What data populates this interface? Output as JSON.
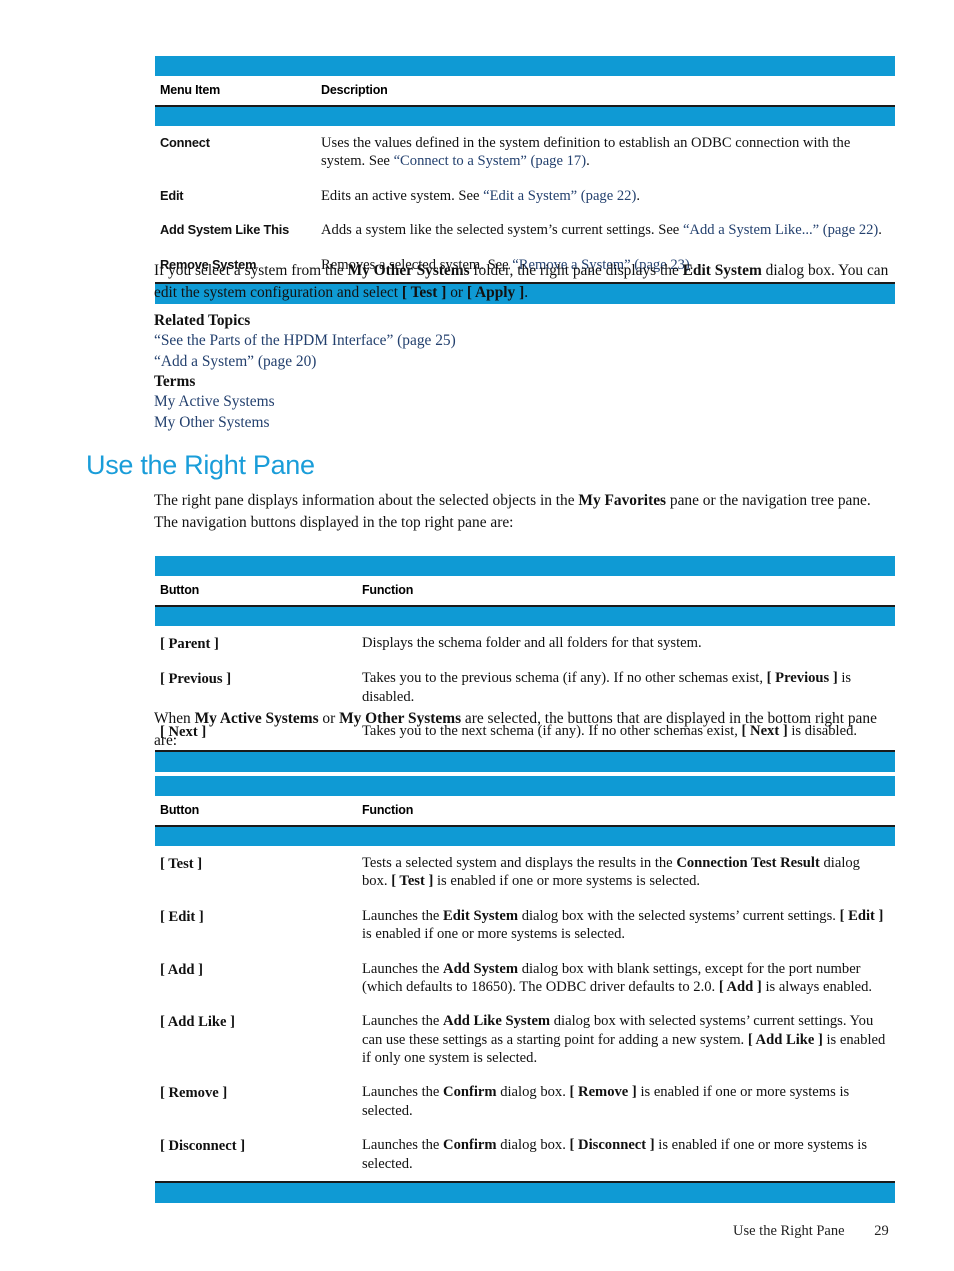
{
  "page": {
    "number": "29",
    "footer_title": "Use the Right Pane"
  },
  "colors": {
    "rule_cyan": "#0f9ad4",
    "rule_dark": "#1a1a1a",
    "heading": "#1a9dd9",
    "link": "#23406e"
  },
  "table_menu": {
    "headers": [
      "Menu Item",
      "Description"
    ],
    "rows": [
      {
        "key": "Connect",
        "desc_parts": [
          {
            "t": "Uses the values defined in the system definition to establish an ODBC connection with the system. See ",
            "style": "plain"
          },
          {
            "t": "“Connect to a System” (page 17)",
            "style": "link"
          },
          {
            "t": ".",
            "style": "plain"
          }
        ]
      },
      {
        "key": "Edit",
        "desc_parts": [
          {
            "t": "Edits an active system. See ",
            "style": "plain"
          },
          {
            "t": "“Edit a System” (page 22)",
            "style": "link"
          },
          {
            "t": ".",
            "style": "plain"
          }
        ]
      },
      {
        "key": "Add System Like This",
        "desc_parts": [
          {
            "t": "Adds a system like the selected system’s current settings. See ",
            "style": "plain"
          },
          {
            "t": "“Add a System Like...” (page 22)",
            "style": "link"
          },
          {
            "t": ".",
            "style": "plain"
          }
        ]
      },
      {
        "key": "Remove System",
        "desc_parts": [
          {
            "t": "Removes a selected system. See ",
            "style": "plain"
          },
          {
            "t": "“Remove a System” (page 23)",
            "style": "link"
          },
          {
            "t": ".",
            "style": "plain"
          }
        ]
      }
    ]
  },
  "para_other_systems": {
    "parts": [
      {
        "t": "If you select a system from the ",
        "style": "plain"
      },
      {
        "t": "My Other Systems",
        "style": "bold"
      },
      {
        "t": " folder, the right pane displays the ",
        "style": "plain"
      },
      {
        "t": "Edit System",
        "style": "bold"
      },
      {
        "t": " dialog box. You can edit the system configuration and select ",
        "style": "plain"
      },
      {
        "t": "[ Test ]",
        "style": "bold"
      },
      {
        "t": " or ",
        "style": "plain"
      },
      {
        "t": "[ Apply ]",
        "style": "bold"
      },
      {
        "t": ".",
        "style": "plain"
      }
    ]
  },
  "related_topics": {
    "heading": "Related Topics",
    "links": [
      "“See the Parts of the HPDM Interface” (page 25)",
      "“Add a System” (page 20)"
    ]
  },
  "terms": {
    "heading": "Terms",
    "links": [
      "My Active Systems",
      "My Other Systems"
    ]
  },
  "section": {
    "title": "Use the Right Pane",
    "intro_parts": [
      {
        "t": "The right pane displays information about the selected objects in the ",
        "style": "plain"
      },
      {
        "t": "My Favorites",
        "style": "bold"
      },
      {
        "t": " pane or the navigation tree pane. The navigation buttons displayed in the top right pane are:",
        "style": "plain"
      }
    ]
  },
  "table_nav_buttons": {
    "headers": [
      "Button",
      "Function"
    ],
    "rows": [
      {
        "key": "[ Parent ]",
        "desc_parts": [
          {
            "t": "Displays the schema folder and all folders for that system.",
            "style": "plain"
          }
        ]
      },
      {
        "key": "[ Previous ]",
        "desc_parts": [
          {
            "t": "Takes you to the previous schema (if any). If no other schemas exist, ",
            "style": "plain"
          },
          {
            "t": "[ Previous ]",
            "style": "bold"
          },
          {
            "t": " is disabled.",
            "style": "plain"
          }
        ]
      },
      {
        "key": "[ Next ]",
        "desc_parts": [
          {
            "t": "Takes you to the next schema (if any). If no other schemas exist, ",
            "style": "plain"
          },
          {
            "t": "[ Next ]",
            "style": "bold"
          },
          {
            "t": " is disabled.",
            "style": "plain"
          }
        ]
      }
    ]
  },
  "para_systems_selected": {
    "parts": [
      {
        "t": "When ",
        "style": "plain"
      },
      {
        "t": "My Active Systems",
        "style": "bold"
      },
      {
        "t": " or ",
        "style": "plain"
      },
      {
        "t": "My Other Systems",
        "style": "bold"
      },
      {
        "t": " are selected, the buttons that are displayed in the bottom right pane are:",
        "style": "plain"
      }
    ]
  },
  "table_bottom_buttons": {
    "headers": [
      "Button",
      "Function"
    ],
    "rows": [
      {
        "key": "[ Test ]",
        "desc_parts": [
          {
            "t": "Tests a selected system and displays the results in the ",
            "style": "plain"
          },
          {
            "t": "Connection Test Result",
            "style": "bold"
          },
          {
            "t": " dialog box. ",
            "style": "plain"
          },
          {
            "t": "[ Test ]",
            "style": "bold"
          },
          {
            "t": " is enabled if one or more systems is selected.",
            "style": "plain"
          }
        ]
      },
      {
        "key": "[ Edit ]",
        "desc_parts": [
          {
            "t": "Launches the ",
            "style": "plain"
          },
          {
            "t": "Edit System",
            "style": "bold"
          },
          {
            "t": " dialog box with the selected systems’ current settings. ",
            "style": "plain"
          },
          {
            "t": "[ Edit ]",
            "style": "bold"
          },
          {
            "t": " is enabled if one or more systems is selected.",
            "style": "plain"
          }
        ]
      },
      {
        "key": "[ Add ]",
        "desc_parts": [
          {
            "t": "Launches the ",
            "style": "plain"
          },
          {
            "t": "Add System",
            "style": "bold"
          },
          {
            "t": " dialog box with blank settings, except for the port number (which defaults to 18650). The ODBC driver defaults to 2.0. ",
            "style": "plain"
          },
          {
            "t": "[ Add ]",
            "style": "bold"
          },
          {
            "t": " is always enabled.",
            "style": "plain"
          }
        ]
      },
      {
        "key": "[ Add Like ]",
        "desc_parts": [
          {
            "t": "Launches the ",
            "style": "plain"
          },
          {
            "t": "Add Like System",
            "style": "bold"
          },
          {
            "t": " dialog box with selected systems’ current settings. You can use these settings as a starting point for adding a new system. ",
            "style": "plain"
          },
          {
            "t": "[ Add Like ]",
            "style": "bold"
          },
          {
            "t": " is enabled if only one system is selected.",
            "style": "plain"
          }
        ]
      },
      {
        "key": "[ Remove ]",
        "desc_parts": [
          {
            "t": "Launches the ",
            "style": "plain"
          },
          {
            "t": "Confirm",
            "style": "bold"
          },
          {
            "t": " dialog box. ",
            "style": "plain"
          },
          {
            "t": "[ Remove ]",
            "style": "bold"
          },
          {
            "t": " is enabled if one or more systems is selected.",
            "style": "plain"
          }
        ]
      },
      {
        "key": "[ Disconnect ]",
        "desc_parts": [
          {
            "t": "Launches the ",
            "style": "plain"
          },
          {
            "t": "Confirm",
            "style": "bold"
          },
          {
            "t": " dialog box. ",
            "style": "plain"
          },
          {
            "t": "[ Disconnect ]",
            "style": "bold"
          },
          {
            "t": " is enabled if one or more systems is selected.",
            "style": "plain"
          }
        ]
      }
    ]
  }
}
